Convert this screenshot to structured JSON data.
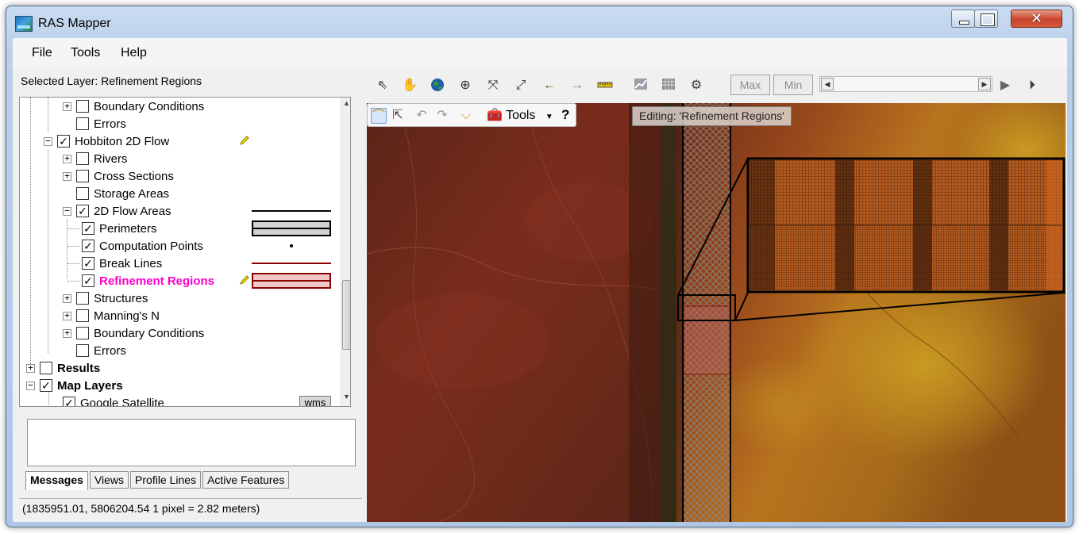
{
  "window": {
    "title": "RAS Mapper",
    "close_glyph": "✕"
  },
  "menu": [
    "File",
    "Tools",
    "Help"
  ],
  "selected_layer_text": "Selected Layer: Refinement Regions",
  "tree": [
    {
      "label": "Boundary Conditions",
      "checked": false
    },
    {
      "label": "Errors",
      "checked": false
    },
    {
      "label": "Hobbiton 2D Flow",
      "checked": true
    },
    {
      "label": "Rivers",
      "checked": false
    },
    {
      "label": "Cross Sections",
      "checked": false
    },
    {
      "label": "Storage Areas",
      "checked": false
    },
    {
      "label": "2D Flow Areas",
      "checked": true
    },
    {
      "label": "Perimeters",
      "checked": true
    },
    {
      "label": "Computation Points",
      "checked": true
    },
    {
      "label": "Break Lines",
      "checked": true
    },
    {
      "label": "Refinement Regions",
      "checked": true
    },
    {
      "label": "Structures",
      "checked": false
    },
    {
      "label": "Manning's N",
      "checked": false
    },
    {
      "label": "Boundary Conditions",
      "checked": false
    },
    {
      "label": "Errors",
      "checked": false
    },
    {
      "label": "Results",
      "checked": false
    },
    {
      "label": "Map Layers",
      "checked": true
    },
    {
      "label": "Google Satellite",
      "checked": true
    }
  ],
  "wms_badge": "wms",
  "bottom_tabs": [
    "Messages",
    "Views",
    "Profile Lines",
    "Active Features"
  ],
  "status_text": "(1835951.01, 5806204.54  1 pixel = 2.82 meters)",
  "toolbar": {
    "max_label": "Max",
    "min_label": "Min"
  },
  "edit_toolbar": {
    "tools_label": "Tools",
    "help_label": "?"
  },
  "editing_label": "Editing: 'Refinement Regions'",
  "colors": {
    "selected_layer_text": "#ff00cc",
    "refinement_fill": "#f0c8c8",
    "refinement_border": "#8b0000",
    "break_line": "#8b0000"
  }
}
